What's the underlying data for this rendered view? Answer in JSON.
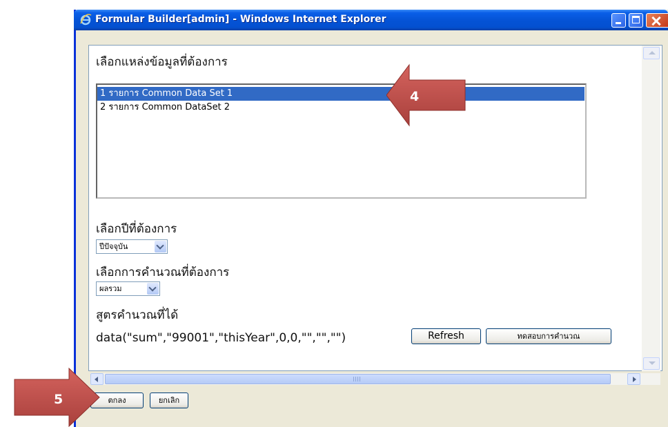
{
  "window": {
    "title": "Formular Builder[admin] - Windows Internet Explorer"
  },
  "form": {
    "source_label": "เลือกแหล่งข้อมูลที่ต้องการ",
    "source_options": [
      "1 รายการ Common Data Set 1",
      "2 รายการ Common DataSet 2"
    ],
    "selected_source_index": 0,
    "year_label": "เลือกปีที่ต้องการ",
    "year_value": "ปีปัจจุบัน",
    "calc_label": "เลือกการคำนวณที่ต้องการ",
    "calc_value": "ผลรวม",
    "formula_label": "สูตรคำนวณที่ได้",
    "formula_value": "data(\"sum\",\"99001\",\"thisYear\",0,0,\"\",\"\",\"\")",
    "refresh_label": "Refresh",
    "test_label": "ทดสอบการคำนวณ"
  },
  "footer": {
    "ok_label": "ตกลง",
    "cancel_label": "ยกเลิก"
  },
  "callouts": {
    "step_4": "4",
    "step_5": "5",
    "color": "#c0504d"
  }
}
